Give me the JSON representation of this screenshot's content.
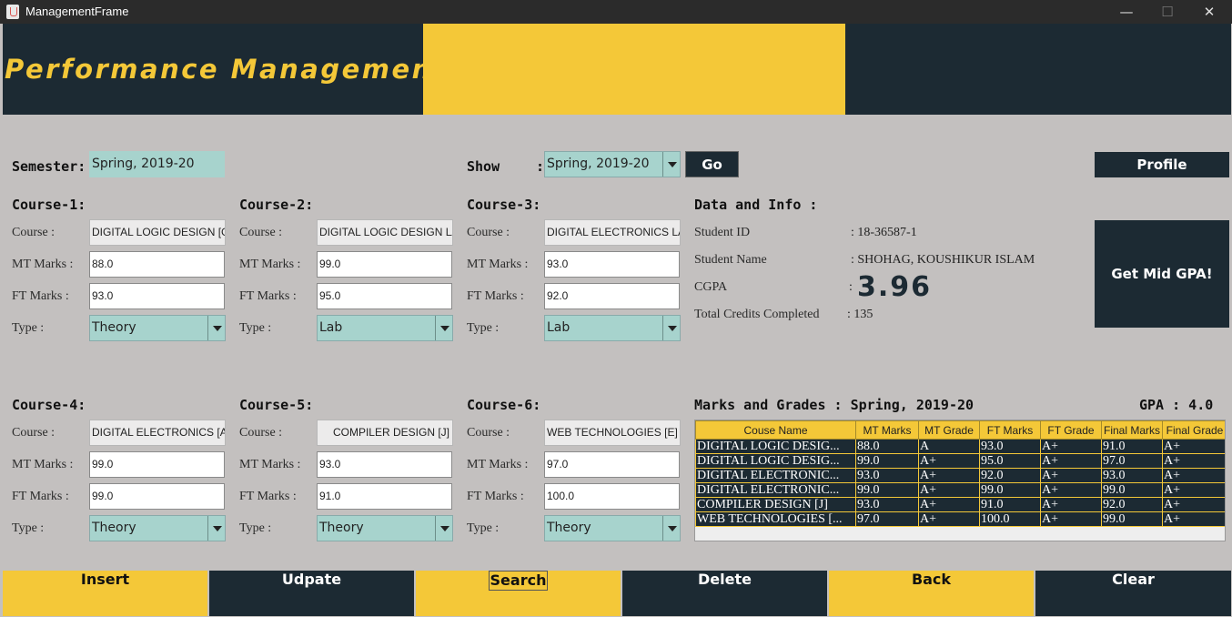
{
  "window": {
    "title": "ManagementFrame",
    "min": "—",
    "max": "☐",
    "close": "✕"
  },
  "header": {
    "title": "Performance Management"
  },
  "semester": {
    "label": "Semester:",
    "value": "Spring, 2019-20"
  },
  "show": {
    "label": "Show",
    "colon": ":",
    "value": "Spring, 2019-20",
    "go": "Go"
  },
  "profile_button": "Profile",
  "labels": {
    "course": "Course :",
    "mt": "MT Marks :",
    "ft": "FT Marks :",
    "type": "Type :"
  },
  "courses": [
    {
      "heading": "Course-1:",
      "course": "DIGITAL LOGIC DESIGN [G]",
      "mt": "88.0",
      "ft": "93.0",
      "type": "Theory"
    },
    {
      "heading": "Course-2:",
      "course": "DIGITAL LOGIC DESIGN LAB [G]",
      "mt": "99.0",
      "ft": "95.0",
      "type": "Lab"
    },
    {
      "heading": "Course-3:",
      "course": "DIGITAL ELECTRONICS LAB [K]",
      "mt": "93.0",
      "ft": "92.0",
      "type": "Lab"
    },
    {
      "heading": "Course-4:",
      "course": "DIGITAL ELECTRONICS [A]",
      "mt": "99.0",
      "ft": "99.0",
      "type": "Theory"
    },
    {
      "heading": "Course-5:",
      "course": "COMPILER DESIGN [J]",
      "mt": "93.0",
      "ft": "91.0",
      "type": "Theory"
    },
    {
      "heading": "Course-6:",
      "course": "WEB TECHNOLOGIES [E]",
      "mt": "97.0",
      "ft": "100.0",
      "type": "Theory"
    }
  ],
  "info": {
    "heading": "Data and Info :",
    "student_id_label": "Student ID",
    "student_id": ": 18-36587-1",
    "student_name_label": "Student Name",
    "student_name": ": SHOHAG, KOUSHIKUR ISLAM",
    "cgpa_label": "CGPA",
    "cgpa_colon": ":",
    "cgpa": "3.96",
    "credits_label": "Total Credits Completed",
    "credits": ": 135"
  },
  "mid_gpa_button": "Get Mid GPA!",
  "marks": {
    "heading": "Marks and Grades : Spring, 2019-20",
    "gpa": "GPA : 4.0",
    "columns": [
      "Couse Name",
      "MT Marks",
      "MT Grade",
      "FT Marks",
      "FT Grade",
      "Final Marks",
      "Final Grade"
    ],
    "rows": [
      [
        "DIGITAL LOGIC DESIG...",
        "88.0",
        "A",
        "93.0",
        "A+",
        "91.0",
        "A+"
      ],
      [
        "DIGITAL LOGIC DESIG...",
        "99.0",
        "A+",
        "95.0",
        "A+",
        "97.0",
        "A+"
      ],
      [
        "DIGITAL ELECTRONIC...",
        "93.0",
        "A+",
        "92.0",
        "A+",
        "93.0",
        "A+"
      ],
      [
        "DIGITAL ELECTRONIC...",
        "99.0",
        "A+",
        "99.0",
        "A+",
        "99.0",
        "A+"
      ],
      [
        "COMPILER DESIGN [J]",
        "93.0",
        "A+",
        "91.0",
        "A+",
        "92.0",
        "A+"
      ],
      [
        "WEB TECHNOLOGIES [...",
        "97.0",
        "A+",
        "100.0",
        "A+",
        "99.0",
        "A+"
      ]
    ]
  },
  "buttons": {
    "insert": "Insert",
    "update": "Udpate",
    "search": "Search",
    "delete": "Delete",
    "back": "Back",
    "clear": "Clear"
  },
  "colors": {
    "dark": "#1c2a33",
    "yellow": "#f4c838",
    "teal": "#a7d3cd",
    "background": "#c3c0bf"
  }
}
